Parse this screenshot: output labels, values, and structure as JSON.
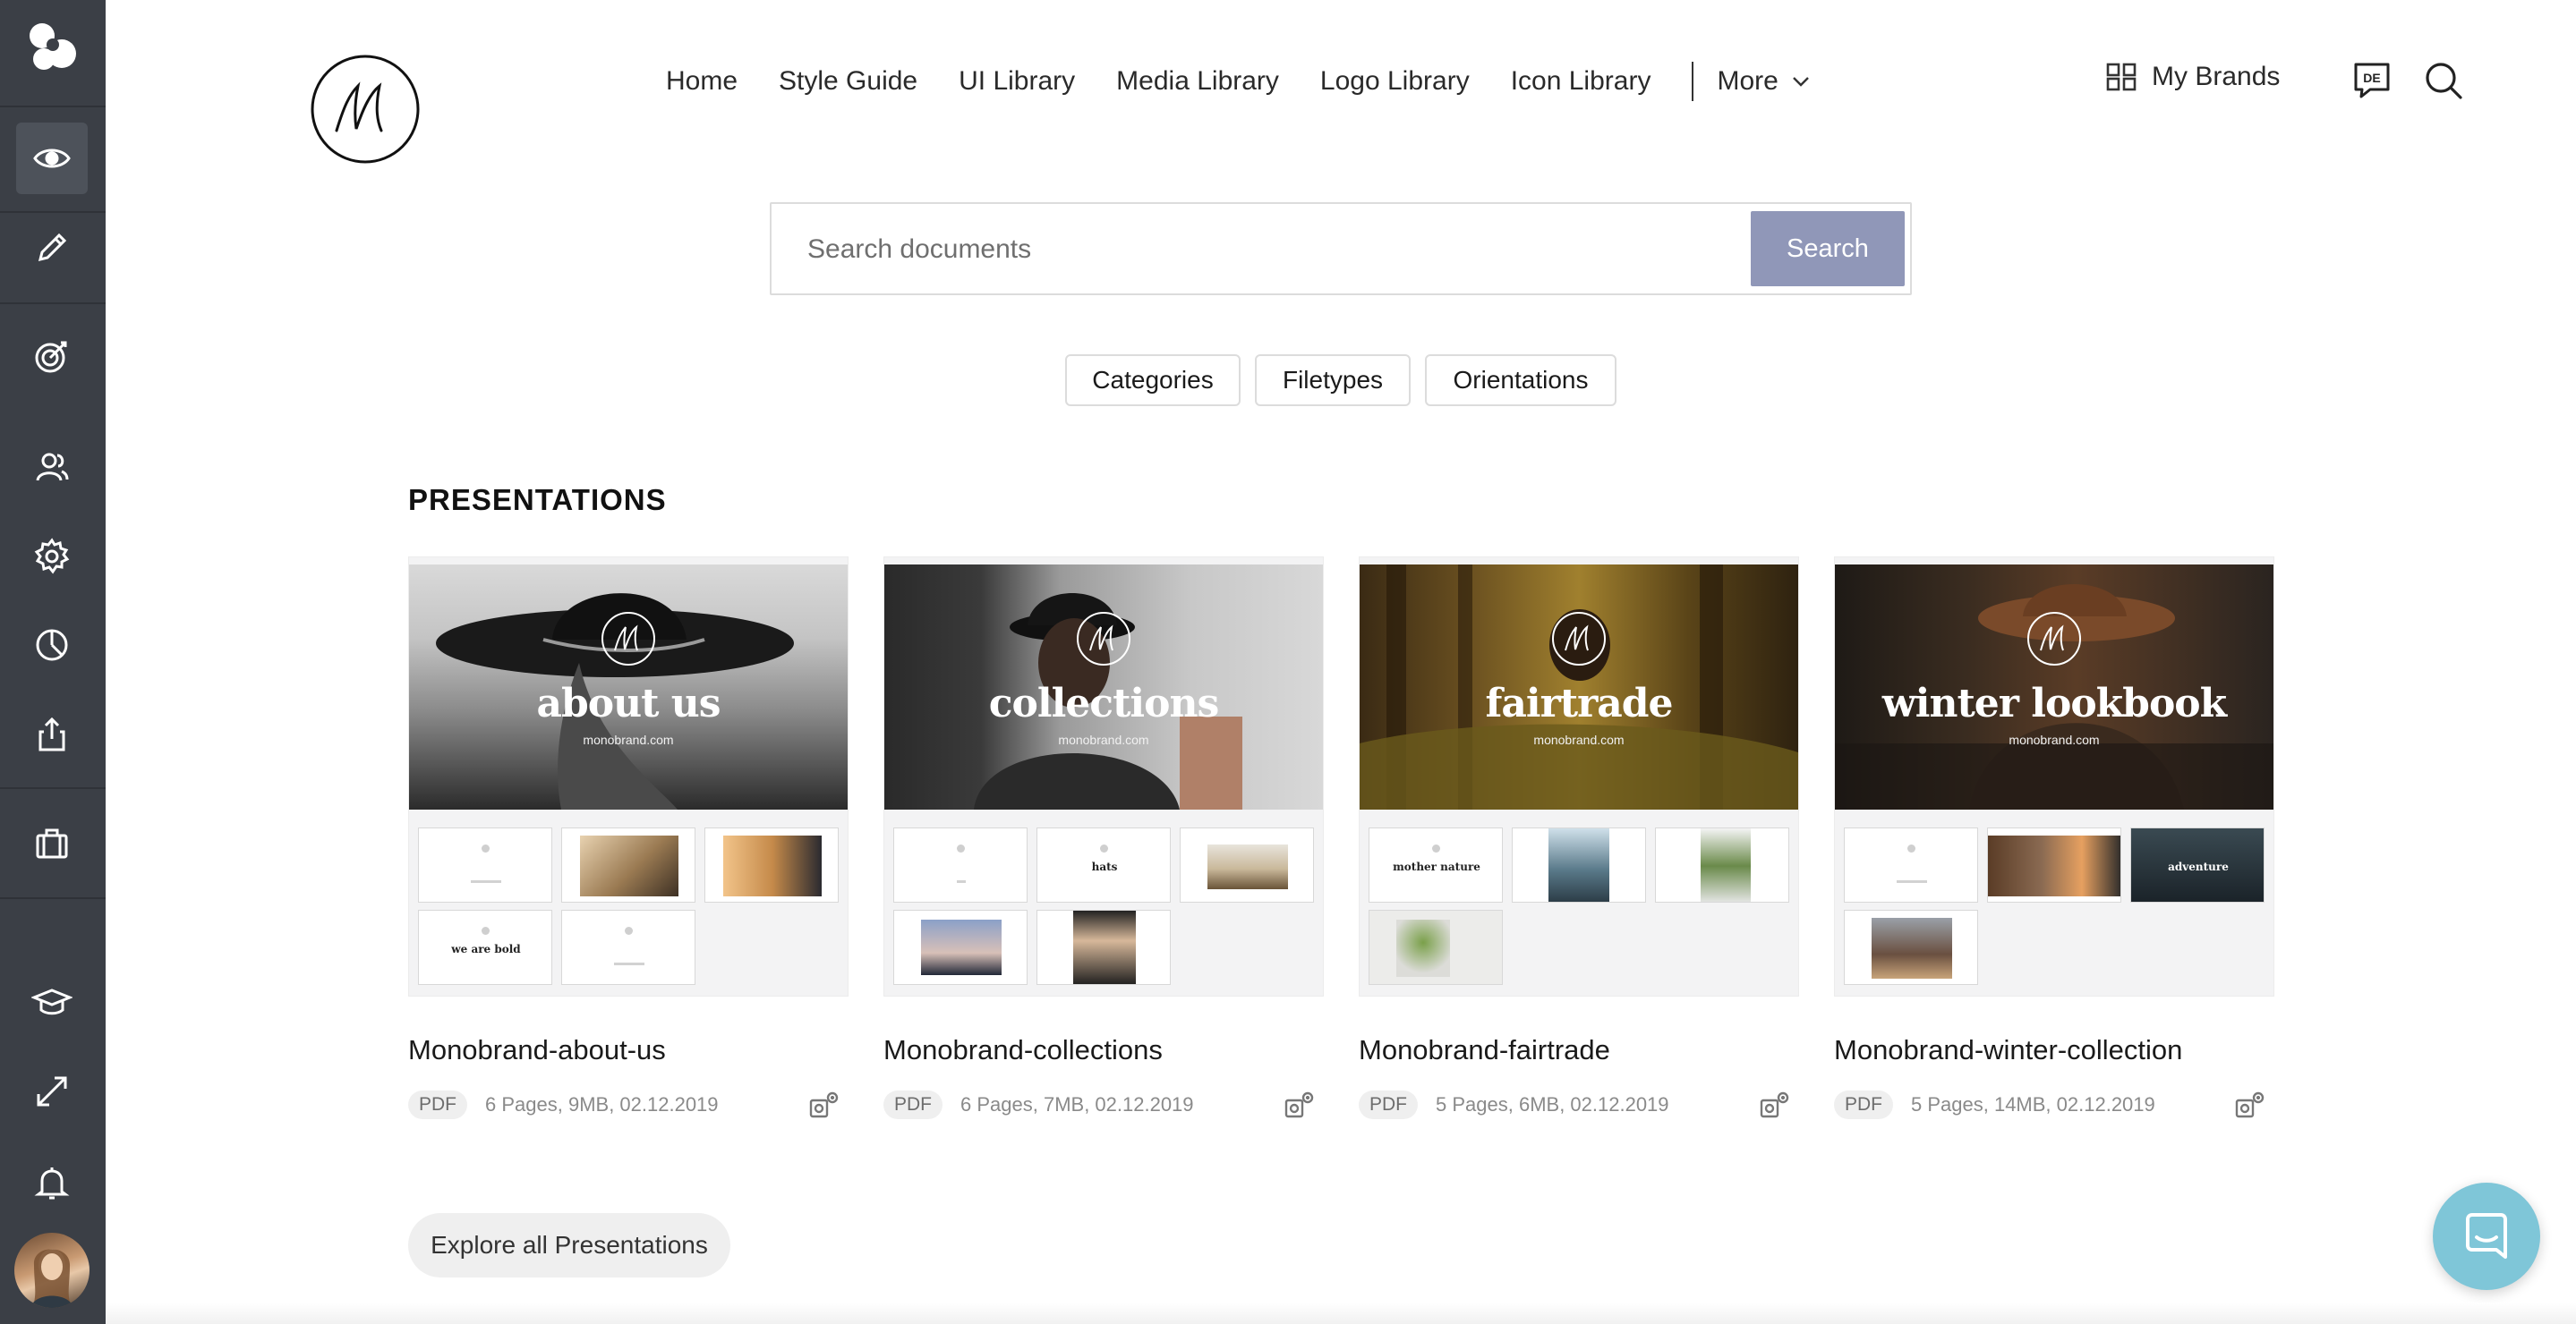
{
  "colors": {
    "sidebar_bg": "#3b3f46",
    "sidebar_active": "#4d525a",
    "search_button": "#9097b8",
    "chat_fab": "#7fc6d8"
  },
  "sidebar": {
    "items": [
      {
        "name": "preview-eye-icon",
        "active": true
      },
      {
        "name": "edit-pencil-icon"
      },
      {
        "name": "target-icon"
      },
      {
        "name": "users-icon"
      },
      {
        "name": "settings-gear-icon"
      },
      {
        "name": "analytics-pie-icon"
      },
      {
        "name": "share-export-icon"
      },
      {
        "name": "briefcase-icon"
      },
      {
        "name": "academy-graduation-icon"
      },
      {
        "name": "expand-fullscreen-icon"
      },
      {
        "name": "notifications-bell-icon"
      }
    ]
  },
  "nav": {
    "items": [
      "Home",
      "Style Guide",
      "UI Library",
      "Media Library",
      "Logo Library",
      "Icon Library"
    ],
    "more_label": "More",
    "my_brands_label": "My Brands",
    "language_badge": "DE"
  },
  "search": {
    "placeholder": "Search documents",
    "button_label": "Search"
  },
  "filters": [
    "Categories",
    "Filetypes",
    "Orientations"
  ],
  "section": {
    "title": "PRESENTATIONS"
  },
  "presentations": [
    {
      "cover_title": "about us",
      "cover_subtitle": "monobrand.com",
      "title": "Monobrand-about-us",
      "filetype": "PDF",
      "meta": "6 Pages, 9MB, 02.12.2019",
      "slide_texts": [
        "",
        "",
        "",
        "we are bold",
        ""
      ]
    },
    {
      "cover_title": "collections",
      "cover_subtitle": "monobrand.com",
      "title": "Monobrand-collections",
      "filetype": "PDF",
      "meta": "6 Pages, 7MB, 02.12.2019",
      "slide_texts": [
        "",
        "hats",
        "",
        "",
        ""
      ]
    },
    {
      "cover_title": "fairtrade",
      "cover_subtitle": "monobrand.com",
      "title": "Monobrand-fairtrade",
      "filetype": "PDF",
      "meta": "5 Pages, 6MB, 02.12.2019",
      "slide_texts": [
        "mother nature",
        "",
        "",
        ""
      ]
    },
    {
      "cover_title": "winter lookbook",
      "cover_subtitle": "monobrand.com",
      "title": "Monobrand-winter-collection",
      "filetype": "PDF",
      "meta": "5 Pages, 14MB, 02.12.2019",
      "slide_texts": [
        "",
        "",
        "adventure",
        ""
      ]
    }
  ],
  "explore_label": "Explore all Presentations"
}
